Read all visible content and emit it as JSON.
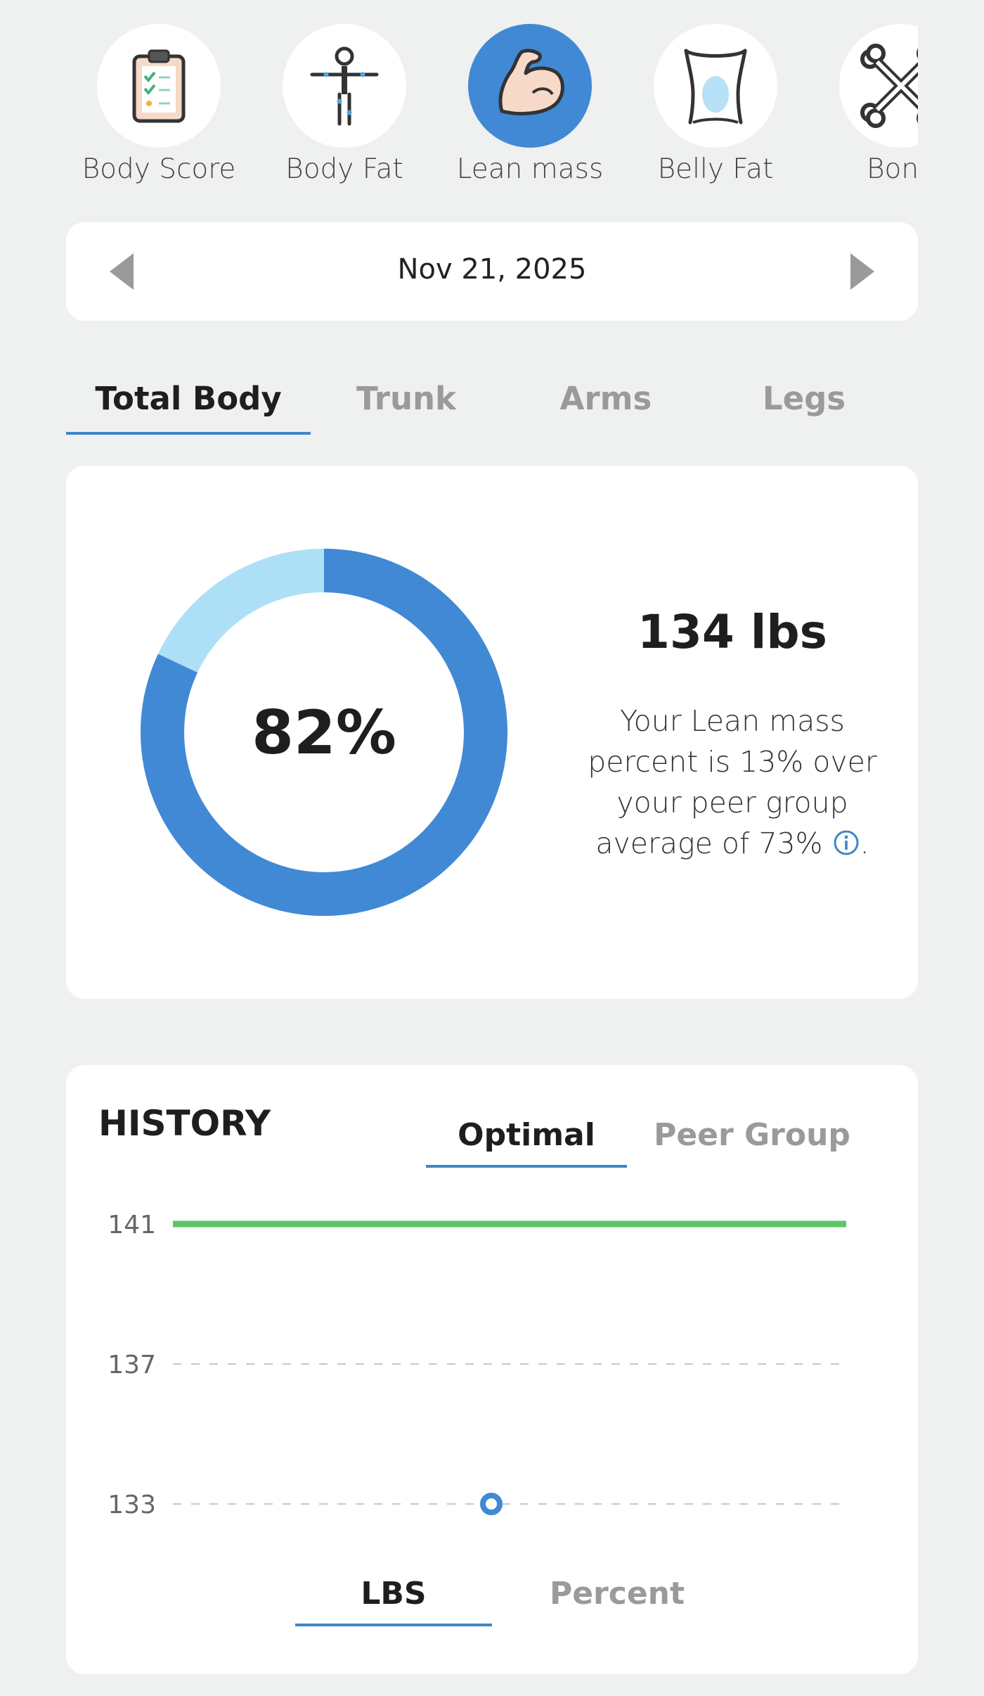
{
  "metrics": [
    {
      "label": "Body Score",
      "icon": "clipboard-checklist-icon",
      "active": false
    },
    {
      "label": "Body Fat",
      "icon": "body-figure-icon",
      "active": false
    },
    {
      "label": "Lean mass",
      "icon": "flexed-arm-icon",
      "active": true
    },
    {
      "label": "Belly Fat",
      "icon": "torso-icon",
      "active": false
    },
    {
      "label": "Bone",
      "icon": "crossed-bones-icon",
      "active": false
    }
  ],
  "date_nav": {
    "date": "Nov 21, 2025",
    "prev_icon": "chevron-left-icon",
    "next_icon": "chevron-right-icon"
  },
  "region_tabs": [
    {
      "label": "Total Body",
      "active": true
    },
    {
      "label": "Trunk",
      "active": false
    },
    {
      "label": "Arms",
      "active": false
    },
    {
      "label": "Legs",
      "active": false
    }
  ],
  "summary": {
    "percent_label": "82%",
    "percent_value": 82,
    "weight": "134 lbs",
    "description": "Your Lean mass percent is 13% over your peer group average of 73%",
    "description_end": ".",
    "info_icon": "info-icon"
  },
  "history": {
    "title": "HISTORY",
    "tabs": [
      {
        "label": "Optimal",
        "active": true
      },
      {
        "label": "Peer Group",
        "active": false
      }
    ],
    "unit_tabs": [
      {
        "label": "LBS",
        "active": true
      },
      {
        "label": "Percent",
        "active": false
      }
    ]
  },
  "chart_data": {
    "type": "line",
    "y_ticks": [
      "141",
      "137",
      "133"
    ],
    "ylim": [
      133,
      141
    ],
    "grid": "dashed horizontal",
    "series": [
      {
        "role": "optimal-reference",
        "values": [
          141,
          141
        ],
        "color": "#5cc465"
      },
      {
        "role": "measurement",
        "values": [
          133
        ],
        "color": "#4189d5"
      }
    ]
  },
  "colors": {
    "accent": "#4189d5",
    "accent_light": "#ade0f6",
    "optimal_line": "#5cc465",
    "background": "#eff0f0",
    "card": "#ffffff"
  }
}
